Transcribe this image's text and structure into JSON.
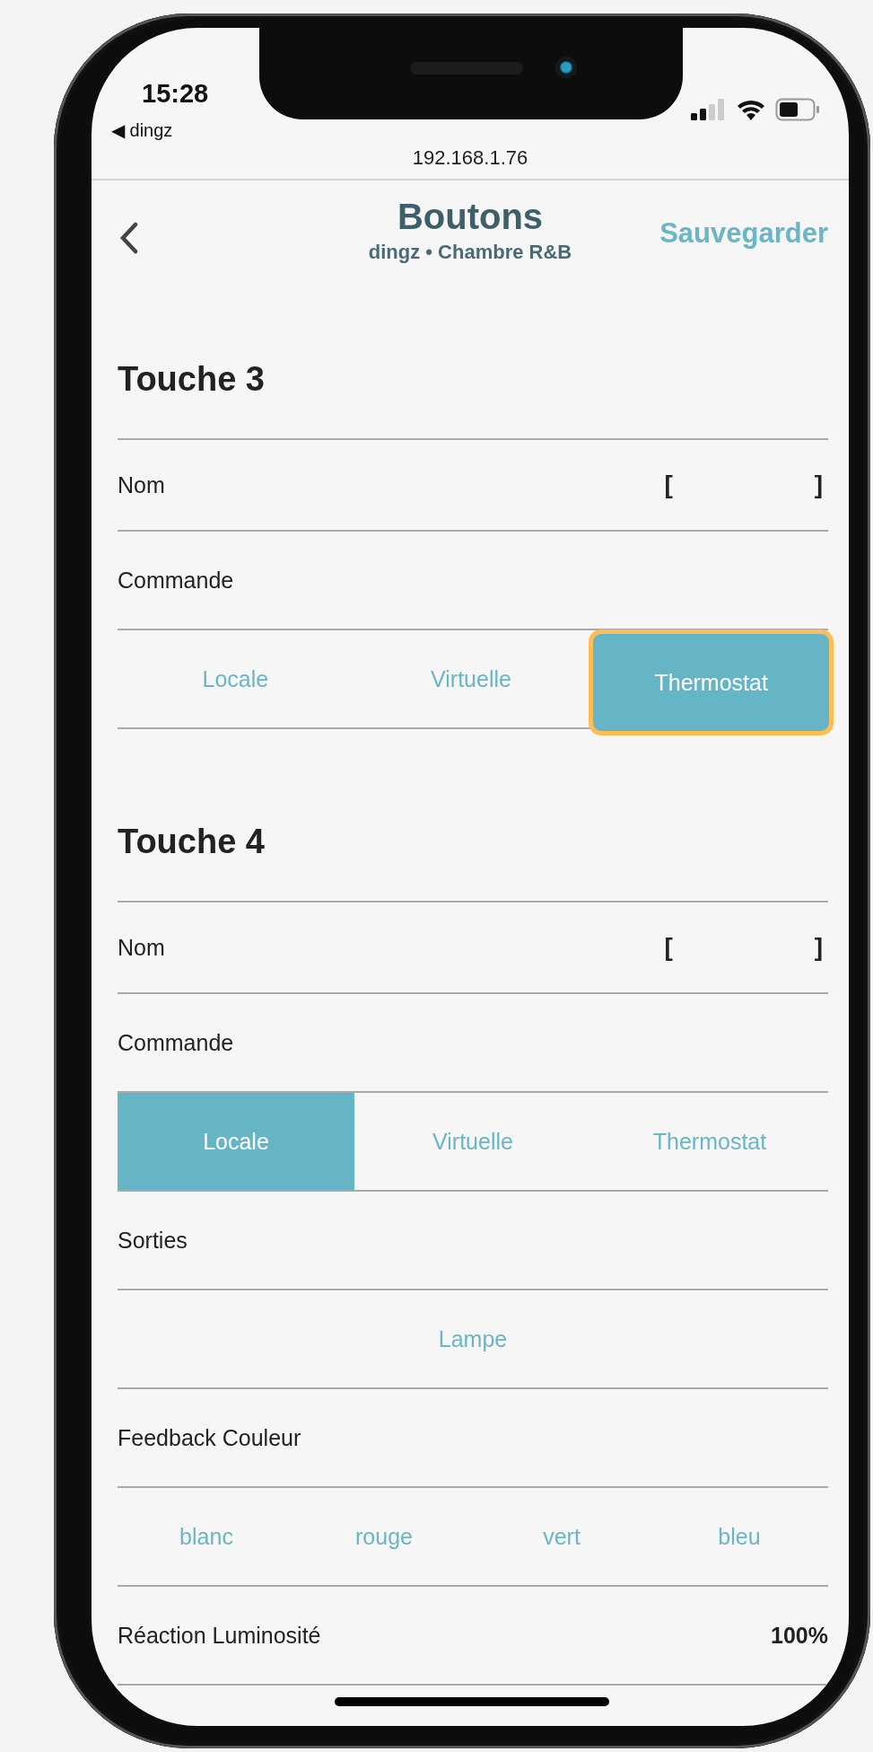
{
  "status_bar": {
    "time": "15:28",
    "back_app": "◀ dingz"
  },
  "address_bar": {
    "url": "192.168.1.76"
  },
  "nav": {
    "title": "Boutons",
    "subtitle": "dingz • Chambre R&B",
    "action": "Sauvegarder"
  },
  "sections": [
    {
      "title": "Touche 3",
      "rows": [
        {
          "kind": "field",
          "label": "Nom",
          "value": "[ ]"
        },
        {
          "kind": "label",
          "label": "Commande"
        },
        {
          "kind": "segments",
          "options": [
            {
              "label": "Locale",
              "selected": false,
              "highlighted": false
            },
            {
              "label": "Virtuelle",
              "selected": false,
              "highlighted": false
            },
            {
              "label": "Thermostat",
              "selected": true,
              "highlighted": true
            }
          ]
        }
      ]
    },
    {
      "title": "Touche 4",
      "rows": [
        {
          "kind": "field",
          "label": "Nom",
          "value": "[ ]"
        },
        {
          "kind": "label",
          "label": "Commande"
        },
        {
          "kind": "segments",
          "options": [
            {
              "label": "Locale",
              "selected": true,
              "highlighted": false
            },
            {
              "label": "Virtuelle",
              "selected": false,
              "highlighted": false
            },
            {
              "label": "Thermostat",
              "selected": false,
              "highlighted": false
            }
          ]
        },
        {
          "kind": "label",
          "label": "Sorties"
        },
        {
          "kind": "segments",
          "options": [
            {
              "label": "Lampe",
              "selected": false,
              "highlighted": false
            }
          ]
        },
        {
          "kind": "label",
          "label": "Feedback Couleur"
        },
        {
          "kind": "segments",
          "options": [
            {
              "label": "blanc",
              "selected": false,
              "highlighted": false
            },
            {
              "label": "rouge",
              "selected": false,
              "highlighted": false
            },
            {
              "label": "vert",
              "selected": false,
              "highlighted": false
            },
            {
              "label": "bleu",
              "selected": false,
              "highlighted": false
            }
          ]
        },
        {
          "kind": "value",
          "label": "Réaction Luminosité",
          "value": "100%"
        }
      ]
    }
  ]
}
